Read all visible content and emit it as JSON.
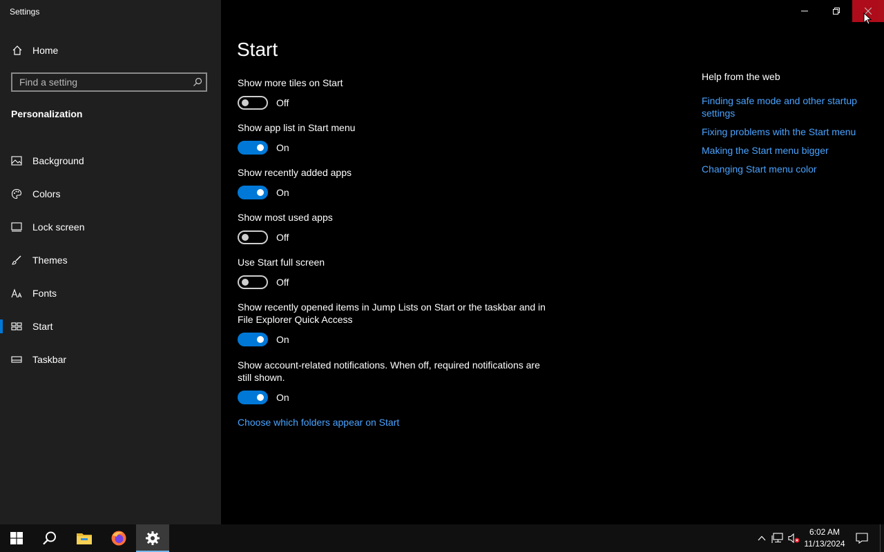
{
  "window": {
    "title": "Settings",
    "minimize_icon": "minimize-icon",
    "maximize_icon": "restore-icon",
    "close_icon": "close-icon"
  },
  "sidebar": {
    "home_label": "Home",
    "search_placeholder": "Find a setting",
    "section_title": "Personalization",
    "items": [
      {
        "label": "Background",
        "icon": "image-icon"
      },
      {
        "label": "Colors",
        "icon": "palette-icon"
      },
      {
        "label": "Lock screen",
        "icon": "lock-screen-icon"
      },
      {
        "label": "Themes",
        "icon": "brush-icon"
      },
      {
        "label": "Fonts",
        "icon": "font-icon"
      },
      {
        "label": "Start",
        "icon": "start-layout-icon",
        "selected": true
      },
      {
        "label": "Taskbar",
        "icon": "taskbar-icon"
      }
    ]
  },
  "main": {
    "title": "Start",
    "settings": [
      {
        "label": "Show more tiles on Start",
        "state": "Off"
      },
      {
        "label": "Show app list in Start menu",
        "state": "On"
      },
      {
        "label": "Show recently added apps",
        "state": "On"
      },
      {
        "label": "Show most used apps",
        "state": "Off"
      },
      {
        "label": "Use Start full screen",
        "state": "Off"
      },
      {
        "label": "Show recently opened items in Jump Lists on Start or the taskbar and in File Explorer Quick Access",
        "state": "On"
      },
      {
        "label": "Show account-related notifications. When off, required notifications are still shown.",
        "state": "On"
      }
    ],
    "folders_link": "Choose which folders appear on Start"
  },
  "help": {
    "title": "Help from the web",
    "links": [
      "Finding safe mode and other startup settings",
      "Fixing problems with the Start menu",
      "Making the Start menu bigger",
      "Changing Start menu color"
    ]
  },
  "taskbar": {
    "items": [
      "windows-start-icon",
      "search-icon",
      "file-explorer-icon",
      "firefox-icon",
      "settings-gear-icon"
    ],
    "clock_time": "6:02 AM",
    "clock_date": "11/13/2024"
  },
  "colors": {
    "accent": "#0078d7",
    "link": "#4aa3ff",
    "sidebar_bg": "#1f1f1f",
    "close_hover": "#e81123"
  }
}
